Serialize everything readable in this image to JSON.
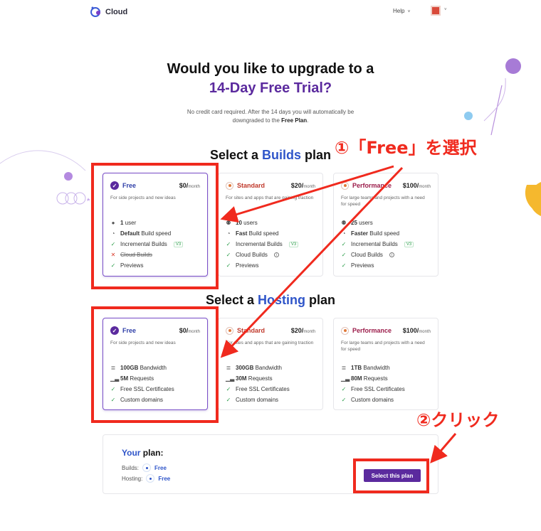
{
  "header": {
    "logo_text": "Cloud",
    "help_label": "Help",
    "caret": "˅"
  },
  "hero": {
    "title_line1": "Would you like to upgrade to a",
    "title_line2": "14-Day Free Trial?",
    "subtext_pre": "No credit card required. After the 14 days you will automatically be downgraded to the ",
    "subtext_bold": "Free Plan",
    "subtext_post": "."
  },
  "builds_section": {
    "title_pre": "Select a ",
    "title_highlight": "Builds",
    "title_post": " plan",
    "plans": [
      {
        "name": "Free",
        "price": "$0/",
        "period": "month",
        "selected": true,
        "desc": "For side projects and new ideas",
        "features": [
          {
            "icon": "user-icon",
            "bold": "1",
            "text": " user"
          },
          {
            "icon": "speed-icon",
            "bold": "Default",
            "text": " Build speed"
          },
          {
            "icon": "check-icon",
            "bold": "",
            "text": "Incremental Builds",
            "badge": "V3"
          },
          {
            "icon": "cross-icon",
            "bold": "",
            "text": "Cloud Builds",
            "strike": true
          },
          {
            "icon": "check-icon",
            "bold": "",
            "text": "Previews"
          }
        ]
      },
      {
        "name": "Standard",
        "price": "$20/",
        "period": "month",
        "selected": false,
        "desc": "For sites and apps that are gaining traction",
        "features": [
          {
            "icon": "users-icon",
            "bold": "10",
            "text": " users"
          },
          {
            "icon": "speed-icon",
            "bold": "Fast",
            "text": " Build speed"
          },
          {
            "icon": "check-icon",
            "bold": "",
            "text": "Incremental Builds",
            "badge": "V3"
          },
          {
            "icon": "check-icon",
            "bold": "",
            "text": "Cloud Builds",
            "info": true
          },
          {
            "icon": "check-icon",
            "bold": "",
            "text": "Previews"
          }
        ]
      },
      {
        "name": "Performance",
        "price": "$100/",
        "period": "month",
        "selected": false,
        "desc": "For large teams and projects with a need for speed",
        "features": [
          {
            "icon": "users-icon",
            "bold": "25",
            "text": " users"
          },
          {
            "icon": "speed-icon",
            "bold": "Faster",
            "text": " Build speed"
          },
          {
            "icon": "check-icon",
            "bold": "",
            "text": "Incremental Builds",
            "badge": "V3"
          },
          {
            "icon": "check-icon",
            "bold": "",
            "text": "Cloud Builds",
            "info": true
          },
          {
            "icon": "check-icon",
            "bold": "",
            "text": "Previews"
          }
        ]
      }
    ]
  },
  "hosting_section": {
    "title_pre": "Select a ",
    "title_highlight": "Hosting",
    "title_post": " plan",
    "plans": [
      {
        "name": "Free",
        "price": "$0/",
        "period": "month",
        "selected": true,
        "desc": "For side projects and new ideas",
        "features": [
          {
            "icon": "database-icon",
            "bold": "100GB",
            "text": " Bandwidth"
          },
          {
            "icon": "signal-icon",
            "bold": "5M",
            "text": " Requests"
          },
          {
            "icon": "check-icon",
            "bold": "",
            "text": "Free SSL Certificates"
          },
          {
            "icon": "check-icon",
            "bold": "",
            "text": "Custom domains"
          }
        ]
      },
      {
        "name": "Standard",
        "price": "$20/",
        "period": "month",
        "selected": false,
        "desc": "For sites and apps that are gaining traction",
        "features": [
          {
            "icon": "database-icon",
            "bold": "300GB",
            "text": " Bandwidth"
          },
          {
            "icon": "signal-icon",
            "bold": "30M",
            "text": " Requests"
          },
          {
            "icon": "check-icon",
            "bold": "",
            "text": "Free SSL Certificates"
          },
          {
            "icon": "check-icon",
            "bold": "",
            "text": "Custom domains"
          }
        ]
      },
      {
        "name": "Performance",
        "price": "$100/",
        "period": "month",
        "selected": false,
        "desc": "For large teams and projects with a need for speed",
        "features": [
          {
            "icon": "database-icon",
            "bold": "1TB",
            "text": " Bandwidth"
          },
          {
            "icon": "signal-icon",
            "bold": "80M",
            "text": " Requests"
          },
          {
            "icon": "check-icon",
            "bold": "",
            "text": "Free SSL Certificates"
          },
          {
            "icon": "check-icon",
            "bold": "",
            "text": "Custom domains"
          }
        ]
      }
    ]
  },
  "your_plan": {
    "title_highlight": "Your",
    "title_rest": " plan:",
    "builds_label": "Builds:",
    "builds_value": "Free",
    "hosting_label": "Hosting:",
    "hosting_value": "Free",
    "button_label": "Select this plan"
  },
  "annotations": {
    "step1": "①「Free」を選択",
    "step2": "②クリック"
  },
  "colors": {
    "accent_purple": "#5b2a9e",
    "highlight_blue": "#2f55c9",
    "annotation_red": "#f02a1e",
    "check_green": "#2e9e4c"
  }
}
